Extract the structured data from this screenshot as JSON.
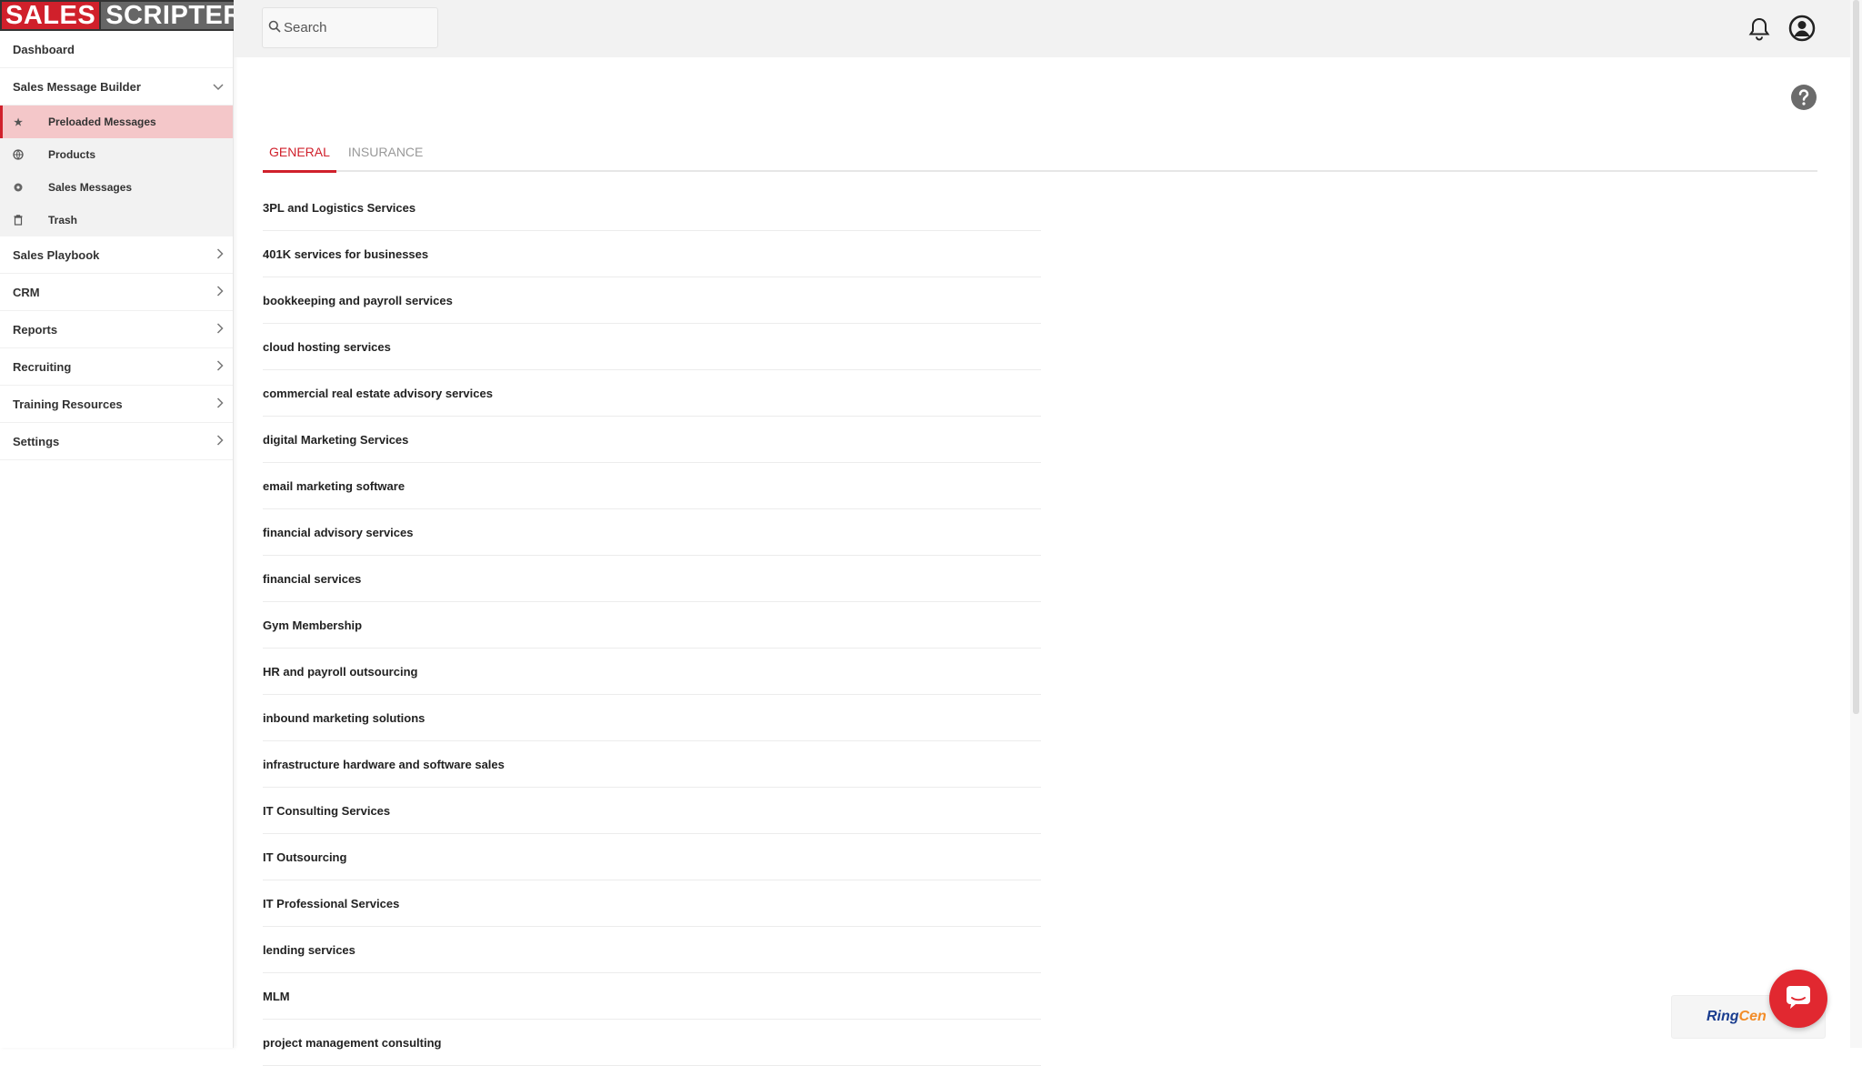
{
  "brand": {
    "part1": "SALES",
    "part2": "SCRIPTER"
  },
  "search": {
    "placeholder": "Search"
  },
  "sidebar": {
    "dashboard": "Dashboard",
    "builder": {
      "label": "Sales Message Builder",
      "items": [
        {
          "label": "Preloaded Messages",
          "icon": "star-icon"
        },
        {
          "label": "Products",
          "icon": "globe-icon"
        },
        {
          "label": "Sales Messages",
          "icon": "gear-icon"
        },
        {
          "label": "Trash",
          "icon": "trash-icon"
        }
      ]
    },
    "sections": [
      {
        "label": "Sales Playbook"
      },
      {
        "label": "CRM"
      },
      {
        "label": "Reports"
      },
      {
        "label": "Recruiting"
      },
      {
        "label": "Training Resources"
      },
      {
        "label": "Settings"
      }
    ]
  },
  "tabs": {
    "general": "GENERAL",
    "insurance": "INSURANCE"
  },
  "messages": [
    "3PL and Logistics Services",
    "401K services for businesses",
    "bookkeeping and payroll services",
    "cloud hosting services",
    "commercial real estate advisory services",
    "digital Marketing Services",
    "email marketing software",
    "financial advisory services",
    "financial services",
    "Gym Membership",
    "HR and payroll outsourcing",
    "inbound marketing solutions",
    "infrastructure hardware and software sales",
    "IT Consulting Services",
    "IT Outsourcing",
    "IT Professional Services",
    "lending services",
    "MLM",
    "project management consulting"
  ],
  "widget": {
    "ring": "Ring",
    "central": "Cen"
  },
  "colors": {
    "accent": "#d0202b",
    "active_bg": "#f4c7c9"
  }
}
